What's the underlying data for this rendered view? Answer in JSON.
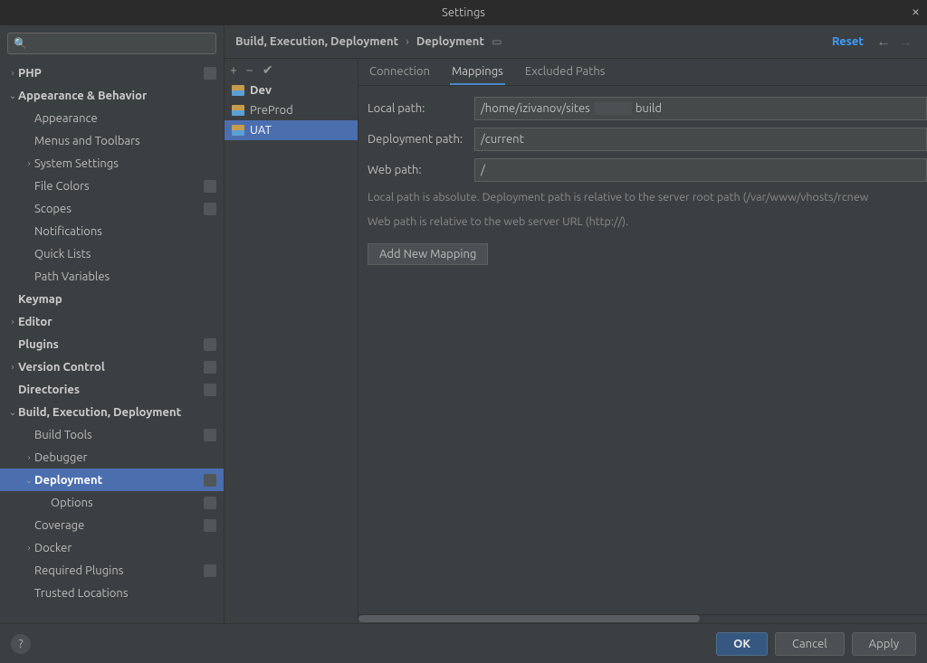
{
  "window": {
    "title": "Settings",
    "reset_label": "Reset"
  },
  "search": {
    "placeholder": ""
  },
  "breadcrumb": {
    "parent": "Build, Execution, Deployment",
    "current": "Deployment"
  },
  "sidebar": {
    "items": [
      {
        "label": "PHP",
        "depth": 0,
        "caret": "›",
        "bold": true,
        "badge": true
      },
      {
        "label": "Appearance & Behavior",
        "depth": 0,
        "caret": "⌄",
        "bold": true
      },
      {
        "label": "Appearance",
        "depth": 1
      },
      {
        "label": "Menus and Toolbars",
        "depth": 1
      },
      {
        "label": "System Settings",
        "depth": 1,
        "caret": "›"
      },
      {
        "label": "File Colors",
        "depth": 1,
        "badge": true
      },
      {
        "label": "Scopes",
        "depth": 1,
        "badge": true
      },
      {
        "label": "Notifications",
        "depth": 1
      },
      {
        "label": "Quick Lists",
        "depth": 1
      },
      {
        "label": "Path Variables",
        "depth": 1
      },
      {
        "label": "Keymap",
        "depth": 0,
        "bold": true
      },
      {
        "label": "Editor",
        "depth": 0,
        "caret": "›",
        "bold": true
      },
      {
        "label": "Plugins",
        "depth": 0,
        "bold": true,
        "badge": true
      },
      {
        "label": "Version Control",
        "depth": 0,
        "caret": "›",
        "bold": true,
        "badge": true
      },
      {
        "label": "Directories",
        "depth": 0,
        "bold": true,
        "badge": true
      },
      {
        "label": "Build, Execution, Deployment",
        "depth": 0,
        "caret": "⌄",
        "bold": true
      },
      {
        "label": "Build Tools",
        "depth": 1,
        "badge": true
      },
      {
        "label": "Debugger",
        "depth": 1,
        "caret": "›"
      },
      {
        "label": "Deployment",
        "depth": 1,
        "caret": "⌄",
        "selected": true,
        "badge": true
      },
      {
        "label": "Options",
        "depth": 2,
        "badge": true
      },
      {
        "label": "Coverage",
        "depth": 1,
        "badge": true
      },
      {
        "label": "Docker",
        "depth": 1,
        "caret": "›"
      },
      {
        "label": "Required Plugins",
        "depth": 1,
        "badge": true
      },
      {
        "label": "Trusted Locations",
        "depth": 1
      }
    ]
  },
  "servers": {
    "items": [
      {
        "label": "Dev",
        "bold": true
      },
      {
        "label": "PreProd"
      },
      {
        "label": "UAT",
        "selected": true
      }
    ]
  },
  "tabs": [
    {
      "label": "Connection"
    },
    {
      "label": "Mappings",
      "active": true
    },
    {
      "label": "Excluded Paths"
    }
  ],
  "form": {
    "local_path_label": "Local path:",
    "local_path_pre": "/home/izivanov/sites",
    "local_path_post": "build",
    "deployment_path_label": "Deployment path:",
    "deployment_path_value": "/current",
    "web_path_label": "Web path:",
    "web_path_value": "/",
    "help1": "Local path is absolute. Deployment path is relative to the server root path (/var/www/vhosts/rcnew",
    "help2": "Web path is relative to the web server URL (http://).",
    "add_mapping_label": "Add New Mapping"
  },
  "footer": {
    "ok": "OK",
    "cancel": "Cancel",
    "apply": "Apply",
    "help": "?"
  }
}
